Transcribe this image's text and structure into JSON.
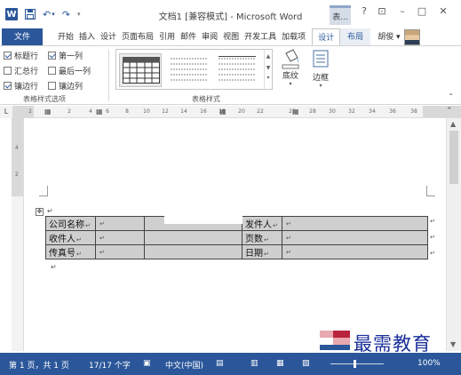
{
  "window": {
    "title": "文档1 [兼容模式] - Microsoft Word",
    "context_tab_title": "表...",
    "controls": {
      "help": "?",
      "ribbon_display": "⊡",
      "minimize": "–",
      "maximize": "□",
      "close": "✕"
    }
  },
  "tabs": {
    "file": "文件",
    "items": [
      "开始",
      "插入",
      "设计",
      "页面布局",
      "引用",
      "邮件",
      "审阅",
      "视图",
      "开发工具",
      "加载项"
    ],
    "context_items": [
      "设计",
      "布局"
    ],
    "active_context": "设计",
    "user": "胡俊 ▾"
  },
  "ribbon": {
    "style_options": {
      "items": [
        {
          "label": "标题行",
          "checked": true
        },
        {
          "label": "第一列",
          "checked": true
        },
        {
          "label": "汇总行",
          "checked": false
        },
        {
          "label": "最后一列",
          "checked": false
        },
        {
          "label": "镶边行",
          "checked": true
        },
        {
          "label": "镶边列",
          "checked": false
        }
      ],
      "group_label": "表格样式选项"
    },
    "table_styles": {
      "group_label": "表格样式"
    },
    "shading_label": "底纹",
    "borders_label": "边框"
  },
  "ruler": {
    "corner": "L",
    "marks": [
      "2",
      "2",
      "4",
      "6",
      "8",
      "10",
      "12",
      "14",
      "16",
      "18",
      "20",
      "22",
      "26",
      "28",
      "30",
      "32",
      "34",
      "36",
      "38"
    ]
  },
  "document": {
    "table": {
      "rows": [
        [
          "公司名称",
          "",
          "",
          "发件人",
          ""
        ],
        [
          "收件人",
          "",
          "",
          "页数",
          ""
        ],
        [
          "传真号",
          "",
          "",
          "日期",
          ""
        ]
      ]
    }
  },
  "status": {
    "page": "第 1 页，共 1 页",
    "words": "17/17 个字",
    "language": "中文(中国)",
    "zoom": "100%"
  },
  "watermark": {
    "text": "最需教育"
  },
  "colors": {
    "accent": "#2b579a",
    "cell_shade": "#cfcfcf",
    "watermark_text": "#1b2f9a"
  }
}
